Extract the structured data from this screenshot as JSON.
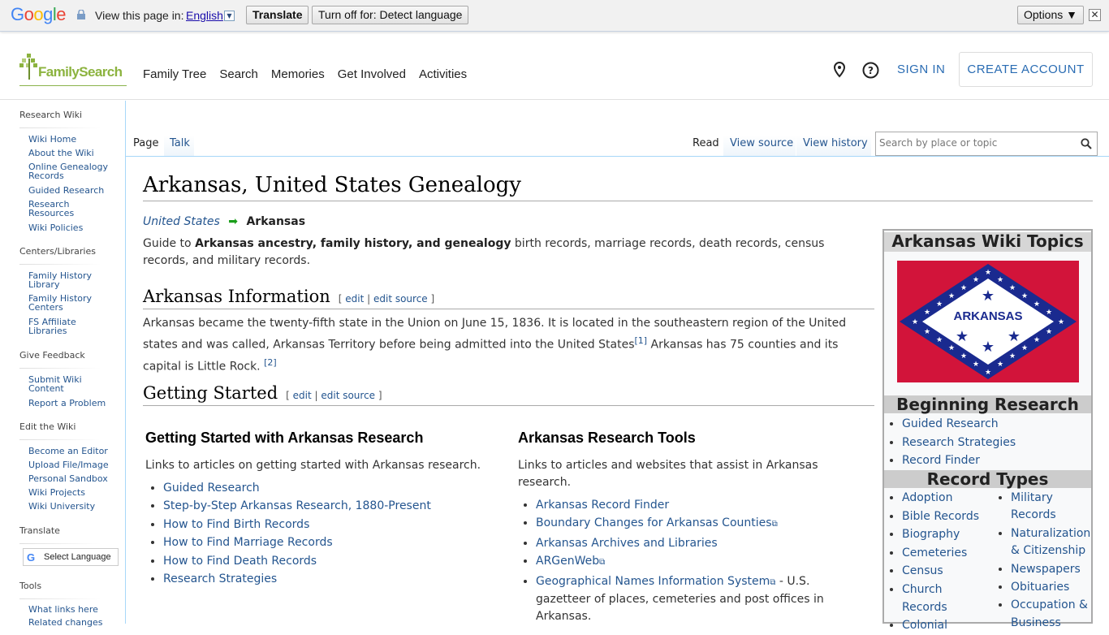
{
  "gtranslate": {
    "logo": "Google",
    "view_label": "View this page in:",
    "language": "English",
    "language_arrow": "▼",
    "translate_button": "Translate",
    "turnoff_button": "Turn off for: Detect language",
    "options_button": "Options ▼",
    "close": "✕"
  },
  "header": {
    "logo": "FamilySearch",
    "nav": [
      "Family Tree",
      "Search",
      "Memories",
      "Get Involved",
      "Activities"
    ],
    "signin": "SIGN IN",
    "create_account": "CREATE ACCOUNT"
  },
  "sidebar": {
    "sections": [
      {
        "heading": "Research Wiki",
        "links": [
          "Wiki Home",
          "About the Wiki",
          "Online Genealogy Records",
          "Guided Research",
          "Research Resources",
          "Wiki Policies"
        ]
      },
      {
        "heading": "Centers/Libraries",
        "links": [
          "Family History Library",
          "Family History Centers",
          "FS Affiliate Libraries"
        ]
      },
      {
        "heading": "Give Feedback",
        "links": [
          "Submit Wiki Content",
          "Report a Problem"
        ]
      },
      {
        "heading": "Edit the Wiki",
        "links": [
          "Become an Editor",
          "Upload File/Image",
          "Personal Sandbox",
          "Wiki Projects",
          "Wiki University"
        ]
      },
      {
        "heading": "Translate",
        "links": []
      },
      {
        "heading": "Tools",
        "links": [
          "What links here",
          "Related changes"
        ]
      }
    ],
    "select_language": "Select Language",
    "select_language_g": "G"
  },
  "tabs": {
    "page": "Page",
    "talk": "Talk",
    "read": "Read",
    "view_source": "View source",
    "view_history": "View history",
    "search_placeholder": "Search by place or topic"
  },
  "article": {
    "title": "Arkansas, United States Genealogy",
    "breadcrumb_parent": "United States",
    "breadcrumb_current": "Arkansas",
    "intro_pre": "Guide to ",
    "intro_bold": "Arkansas ancestry, family history, and genealogy",
    "intro_post": " birth records, marriage records, death records, census records, and military records.",
    "section1_title": "Arkansas Information",
    "edit": "edit",
    "edit_source": "edit source",
    "section1_text_a": "Arkansas became the twenty-fifth state in the Union on June 15, 1836. It is located in the southeastern region of the United states and was called, Arkansas Territory before being admitted into the United States",
    "ref1": "[1]",
    "section1_text_b": " Arkansas has 75 counties and its capital is Little Rock. ",
    "ref2": "[2]",
    "section2_title": "Getting Started",
    "col1_title": "Getting Started with Arkansas Research",
    "col1_desc": "Links to articles on getting started with Arkansas research.",
    "col1_links": [
      "Guided Research",
      "Step-by-Step Arkansas Research, 1880-Present",
      "How to Find Birth Records",
      "How to Find Marriage Records",
      "How to Find Death Records",
      "Research Strategies"
    ],
    "col2_title": "Arkansas Research Tools",
    "col2_desc": "Links to articles and websites that assist in Arkansas research.",
    "col2_links": [
      "Arkansas Record Finder",
      "Boundary Changes for Arkansas Counties",
      "Arkansas Archives and Libraries",
      "ARGenWeb",
      "Geographical Names Information System"
    ],
    "col2_last_suffix": " - U.S. gazetteer of places, cemeteries and post offices in Arkansas."
  },
  "infobox": {
    "title": "Arkansas Wiki Topics",
    "flag_text": "ARKANSAS",
    "flag_colors": {
      "red": "#d2143a",
      "blue": "#1a2a8f",
      "white": "#ffffff"
    },
    "beginning_title": "Beginning Research",
    "beginning_links": [
      "Guided Research",
      "Research Strategies",
      "Record Finder"
    ],
    "record_types_title": "Record Types",
    "record_types_left": [
      "Adoption",
      "Bible Records",
      "Biography",
      "Cemeteries",
      "Census",
      "Church Records",
      "Colonial"
    ],
    "record_types_right": [
      "Military Records",
      "Naturalization & Citizenship",
      "Newspapers",
      "Obituaries",
      "Occupation & Business"
    ]
  }
}
